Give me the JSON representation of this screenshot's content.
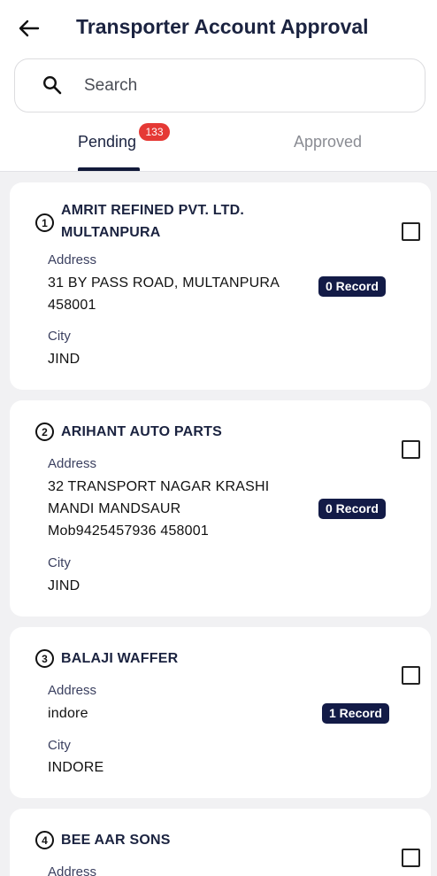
{
  "header": {
    "title": "Transporter Account Approval",
    "back_icon": "arrow-left-icon"
  },
  "search": {
    "placeholder": "Search",
    "value": ""
  },
  "tabs": [
    {
      "label": "Pending",
      "badge": "133",
      "active": true
    },
    {
      "label": "Approved",
      "active": false
    }
  ],
  "labels": {
    "address": "Address",
    "city": "City"
  },
  "cards": [
    {
      "index": "1",
      "name_lines": [
        "AMRIT REFINED PVT. LTD.",
        "MULTANPURA"
      ],
      "address_lines": [
        "31 BY PASS ROAD, MULTANPURA",
        "458001"
      ],
      "city": "JIND",
      "records": "0 Record",
      "checked": false
    },
    {
      "index": "2",
      "name_lines": [
        "ARIHANT AUTO PARTS"
      ],
      "address_lines": [
        "32 TRANSPORT NAGAR KRASHI",
        "MANDI MANDSAUR",
        "Mob9425457936 458001"
      ],
      "city": "JIND",
      "records": "0 Record",
      "checked": false
    },
    {
      "index": "3",
      "name_lines": [
        "BALAJI WAFFER"
      ],
      "address_lines": [
        "indore"
      ],
      "city": "INDORE",
      "records": "1 Record",
      "checked": false
    },
    {
      "index": "4",
      "name_lines": [
        "BEE AAR SONS"
      ],
      "address_lines": [],
      "city": "",
      "records": "",
      "checked": false
    }
  ],
  "colors": {
    "accent": "#131b47",
    "badge": "#e53935",
    "background": "#f1f1f3"
  }
}
